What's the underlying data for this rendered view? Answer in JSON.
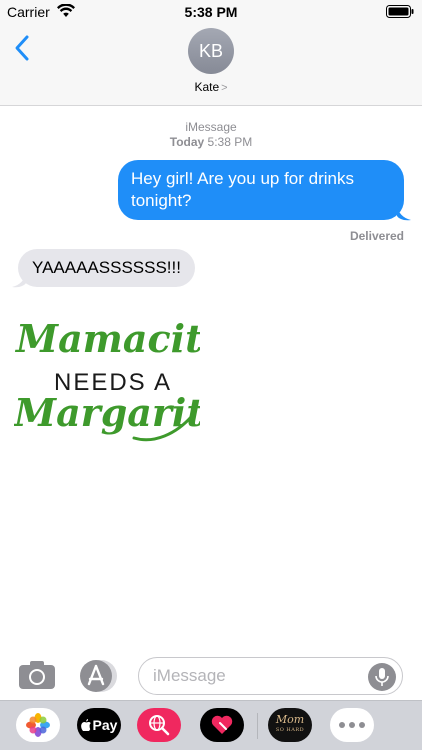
{
  "status_bar": {
    "carrier": "Carrier",
    "time": "5:38 PM"
  },
  "header": {
    "contact_initials": "KB",
    "contact_name": "Kate",
    "contact_chevron": ">"
  },
  "thread": {
    "service": "iMessage",
    "timestamp_day": "Today",
    "timestamp_time": "5:38 PM",
    "messages": [
      {
        "from": "me",
        "text": "Hey girl! Are you up for drinks tonight?"
      },
      {
        "from": "them",
        "text": "YAAAAASSSSSS!!!"
      }
    ],
    "delivery_status": "Delivered",
    "sticker": {
      "line1": "Mamacita",
      "line2": "NEEDS A",
      "line3": "Margarita",
      "color": "#3e9a2c"
    }
  },
  "composer": {
    "placeholder": "iMessage"
  },
  "app_drawer": {
    "apple_pay_label": "Pay",
    "mom_label": "Mom",
    "mom_sub": "SO HARD"
  },
  "colors": {
    "accent": "#1f8ef8",
    "incoming_bubble": "#e6e6eb",
    "search_app": "#f0285f"
  }
}
